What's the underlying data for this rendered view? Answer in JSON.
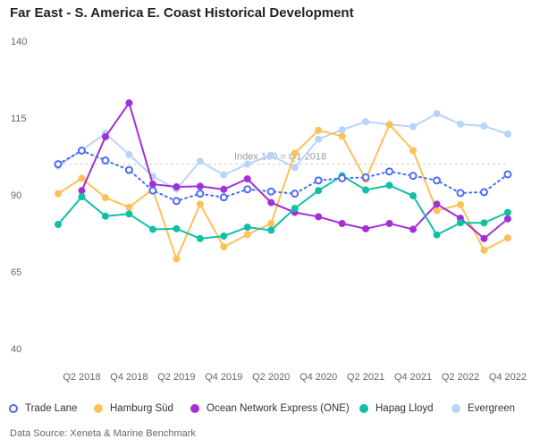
{
  "chart_data": {
    "type": "line",
    "title": "Far East - S. America E. Coast Historical Development",
    "annotation": "Index 100 = Q1 2018",
    "reference_line": 100,
    "x": [
      "Q1 2018",
      "Q2 2018",
      "Q3 2018",
      "Q4 2018",
      "Q1 2019",
      "Q2 2019",
      "Q3 2019",
      "Q4 2019",
      "Q1 2020",
      "Q2 2020",
      "Q3 2020",
      "Q4 2020",
      "Q1 2021",
      "Q2 2021",
      "Q3 2021",
      "Q4 2021",
      "Q1 2022",
      "Q2 2022",
      "Q3 2022",
      "Q4 2022"
    ],
    "x_tick_labels": [
      "Q2 2018",
      "Q4 2018",
      "Q2 2019",
      "Q4 2019",
      "Q2 2020",
      "Q4 2020",
      "Q2 2021",
      "Q4 2021",
      "Q2 2022",
      "Q4 2022"
    ],
    "y_ticks": [
      40,
      65,
      90,
      115,
      140
    ],
    "ylim": [
      40,
      140
    ],
    "grid": false,
    "legend_position": "bottom",
    "series": [
      {
        "name": "Trade Lane",
        "color": "#4a6cf7",
        "style": "dotted-hollow",
        "values": [
          100,
          104.4,
          101.2,
          98.1,
          91.4,
          88.0,
          90.4,
          89.2,
          91.8,
          91.1,
          90.4,
          94.7,
          95.4,
          95.7,
          97.6,
          96.2,
          94.7,
          90.6,
          90.9,
          96.7
        ]
      },
      {
        "name": "Hamburg Süd",
        "color": "#ffc05a",
        "values": [
          90.4,
          95.4,
          89.1,
          86.0,
          91.8,
          69.2,
          87.0,
          73.1,
          77.1,
          80.7,
          103.5,
          111.0,
          109.1,
          95.0,
          112.9,
          104.4,
          84.9,
          86.8,
          72.0,
          76.0
        ]
      },
      {
        "name": "Ocean Network Express (ONE)",
        "color": "#a230d6",
        "values": [
          null,
          91.4,
          108.9,
          119.9,
          93.5,
          92.6,
          92.8,
          91.8,
          95.2,
          87.5,
          84.3,
          82.9,
          80.7,
          79.0,
          80.7,
          78.8,
          87.0,
          82.4,
          75.8,
          82.2
        ]
      },
      {
        "name": "Hapag Lloyd",
        "color": "#10c0a6",
        "values": [
          80.4,
          89.4,
          83.1,
          83.8,
          78.8,
          79.0,
          75.8,
          76.6,
          79.5,
          78.5,
          85.6,
          91.4,
          96.2,
          91.6,
          93.1,
          89.7,
          77.0,
          80.9,
          80.9,
          84.3
        ]
      },
      {
        "name": "Evergreen",
        "color": "#b7d4fb",
        "values": [
          99.4,
          104.5,
          110.0,
          103.1,
          96.0,
          91.9,
          100.9,
          96.5,
          100.0,
          102.9,
          98.9,
          108.1,
          111.2,
          113.8,
          112.9,
          112.2,
          116.4,
          113.0,
          112.4,
          109.8
        ]
      }
    ]
  },
  "footer": {
    "source": "Data Source: Xeneta & Marine Benchmark"
  }
}
